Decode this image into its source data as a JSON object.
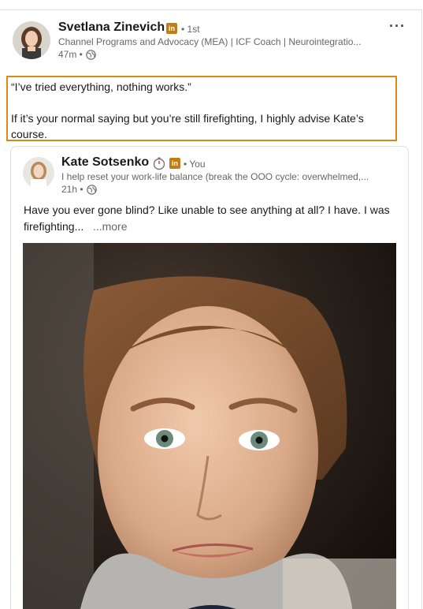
{
  "post": {
    "author": {
      "name": "Svetlana Zinevich",
      "badge": "in",
      "degree": "• 1st",
      "headline": "Channel Programs and Advocacy (MEA) | ICF Coach | Neurointegratio...",
      "time": "47m •"
    },
    "menu_label": "···",
    "text_line1": "“I’ve tried everything, nothing works.”",
    "text_line2": "If it’s your normal saying but you’re still firefighting, I highly advise Kate’s course."
  },
  "shared_post": {
    "author": {
      "name": "Kate Sotsenko",
      "badge": "in",
      "degree": "• You",
      "headline": "I help reset your work-life balance (break the OOO cycle: overwhelmed,...",
      "time": "21h •"
    },
    "text": "Have you ever gone blind? Like unable to see anything at all? I have. I was firefighting...",
    "see_more": "...more"
  },
  "icons": {
    "globe": "globe-icon",
    "timer": "stopwatch-icon",
    "linkedin": "linkedin-premium-icon"
  },
  "colors": {
    "highlight": "#d88a16",
    "badge": "#c37d16"
  }
}
